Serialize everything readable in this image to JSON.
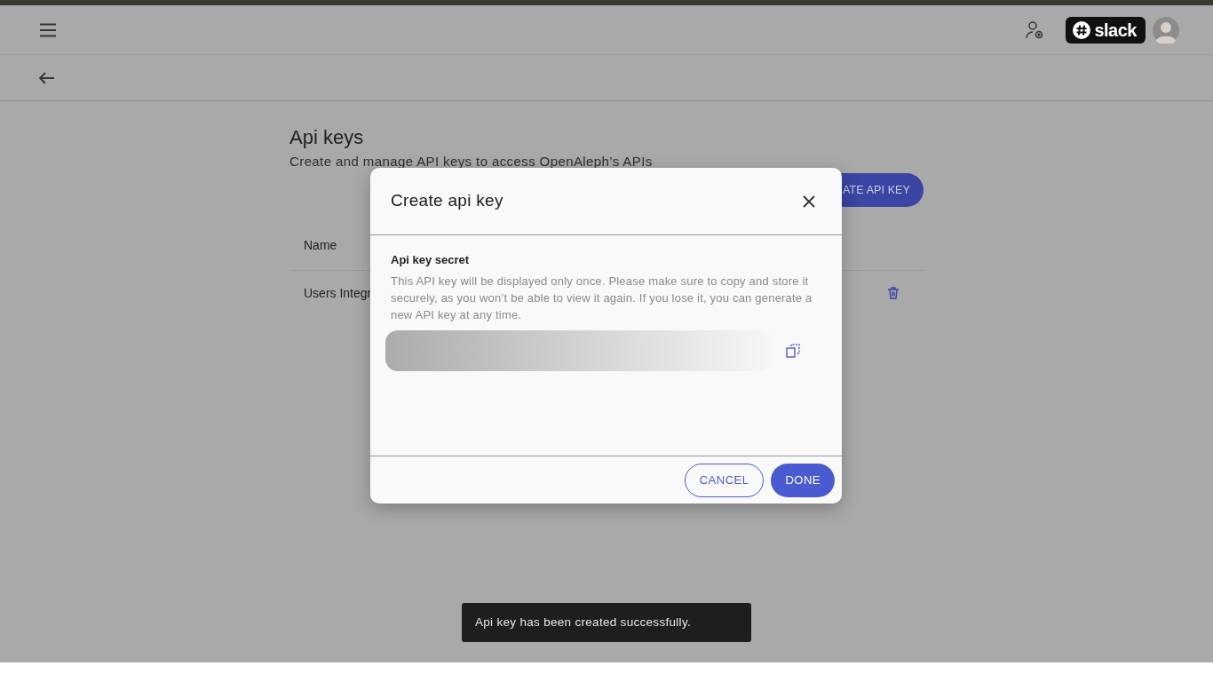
{
  "header": {
    "logo_text": "slack"
  },
  "page": {
    "title": "Api keys",
    "subtitle": "Create and manage API keys to access OpenAleph’s APIs",
    "create_button": "ATE API KEY",
    "table": {
      "columns": [
        "Name"
      ],
      "rows": [
        {
          "name": "Users Integr"
        }
      ]
    }
  },
  "dialog": {
    "title": "Create api key",
    "field_label": "Api key secret",
    "description": "This API key will be displayed only once. Please make sure to copy and store it securely, as you won’t be able to view it again. If you lose it, you can generate a new API key at any time.",
    "buttons": [
      {
        "label": "CANCEL",
        "kind": "outline"
      },
      {
        "label": "DONE",
        "kind": "filled"
      }
    ]
  },
  "toast": {
    "message": "Api key has been created successfully."
  }
}
